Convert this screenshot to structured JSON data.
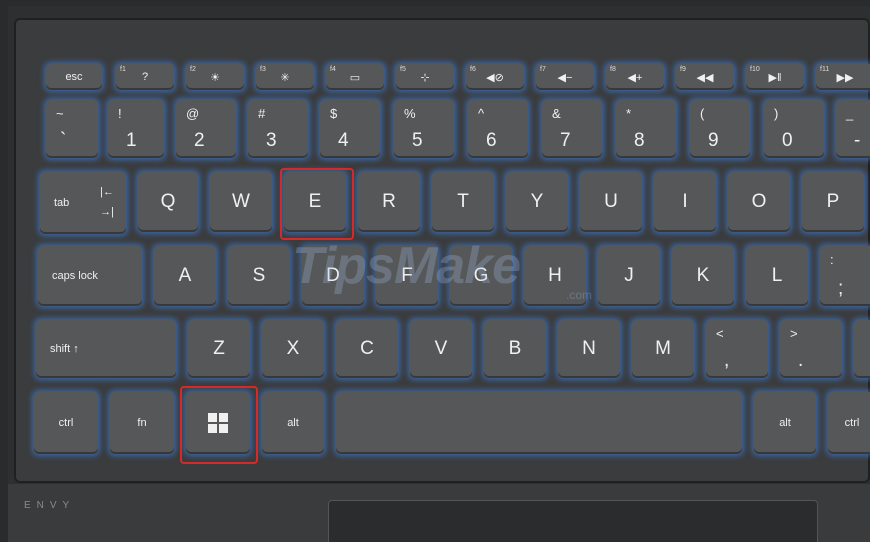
{
  "watermark": {
    "main": "TipsMake",
    "suffix": ".com"
  },
  "brand": "ENVY",
  "fn_row": [
    {
      "label": "esc",
      "fn": "",
      "sym": ""
    },
    {
      "label": "",
      "fn": "f1",
      "sym": "?"
    },
    {
      "label": "",
      "fn": "f2",
      "sym": "☀"
    },
    {
      "label": "",
      "fn": "f3",
      "sym": "✳"
    },
    {
      "label": "",
      "fn": "f4",
      "sym": "▭"
    },
    {
      "label": "",
      "fn": "f5",
      "sym": "⊹"
    },
    {
      "label": "",
      "fn": "f6",
      "sym": "◀⊘"
    },
    {
      "label": "",
      "fn": "f7",
      "sym": "◀−"
    },
    {
      "label": "",
      "fn": "f8",
      "sym": "◀+"
    },
    {
      "label": "",
      "fn": "f9",
      "sym": "◀◀"
    },
    {
      "label": "",
      "fn": "f10",
      "sym": "▶‖"
    },
    {
      "label": "",
      "fn": "f11",
      "sym": "▶▶"
    }
  ],
  "number_row": [
    {
      "top": "~",
      "bot": "`"
    },
    {
      "top": "!",
      "bot": "1"
    },
    {
      "top": "@",
      "bot": "2"
    },
    {
      "top": "#",
      "bot": "3"
    },
    {
      "top": "$",
      "bot": "4"
    },
    {
      "top": "%",
      "bot": "5"
    },
    {
      "top": "^",
      "bot": "6"
    },
    {
      "top": "&",
      "bot": "7"
    },
    {
      "top": "*",
      "bot": "8"
    },
    {
      "top": "(",
      "bot": "9"
    },
    {
      "top": ")",
      "bot": "0"
    },
    {
      "top": "_",
      "bot": "-"
    }
  ],
  "tab_row": {
    "tab": "tab",
    "keys": [
      "Q",
      "W",
      "E",
      "R",
      "T",
      "Y",
      "U",
      "I",
      "O",
      "P"
    ]
  },
  "caps_row": {
    "caps": "caps lock",
    "keys": [
      "A",
      "S",
      "D",
      "F",
      "G",
      "H",
      "J",
      "K",
      "L"
    ],
    "last_top": ":",
    "last_bot": ";"
  },
  "shift_row": {
    "shift": "shift ↑",
    "keys": [
      "Z",
      "X",
      "C",
      "V",
      "B",
      "N",
      "M"
    ],
    "comma_top": "<",
    "comma_bot": ",",
    "period_top": ">",
    "period_bot": "."
  },
  "bottom_row": {
    "ctrl": "ctrl",
    "fn": "fn",
    "alt": "alt",
    "alt_r": "alt",
    "ctrl_r": "ctrl"
  },
  "tab_arrows": {
    "top": "|←",
    "bot": "→|"
  },
  "highlight_color": "#d42a2a",
  "backlight_color": "#3c8cff"
}
